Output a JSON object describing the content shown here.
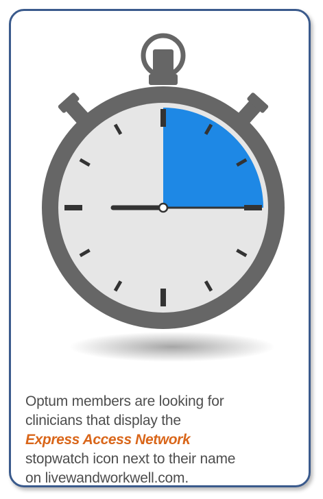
{
  "caption": {
    "line1": "Optum members are looking for",
    "line2": "clinicians that display the",
    "brand": "Express Access Network",
    "line4": "stopwatch icon next to their name",
    "line5": "on livewandworkwell.com."
  },
  "icon": {
    "name": "stopwatch-icon",
    "filled_fraction": 0.25
  },
  "colors": {
    "border": "#3a5a8c",
    "body_gray": "#666666",
    "face": "#e6e6e6",
    "fill_blue": "#1e88e5",
    "brand_orange": "#d9661a",
    "text": "#4d4d4d"
  }
}
